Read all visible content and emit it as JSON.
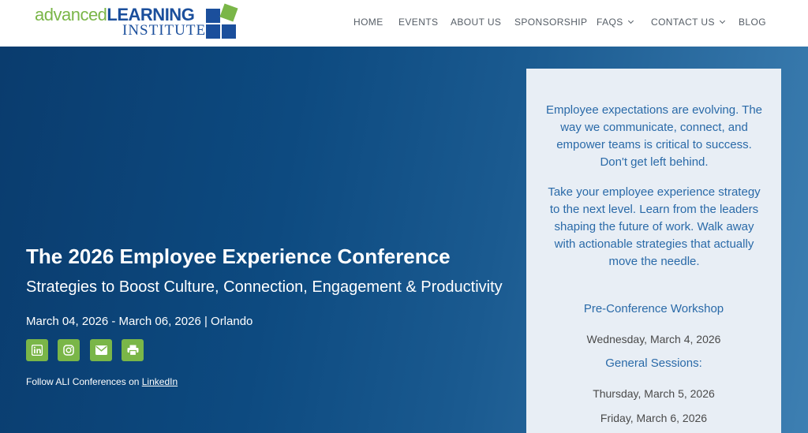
{
  "logo": {
    "word_advanced": "advanced",
    "word_learning": "LEARNING",
    "word_institute": "INSTITUTE",
    "colors": {
      "green": "#7ab648",
      "blue": "#1b4f9c"
    }
  },
  "nav": {
    "items": [
      {
        "label": "HOME"
      },
      {
        "label": "EVENTS"
      },
      {
        "label": "ABOUT US"
      },
      {
        "label": "SPONSORSHIP"
      },
      {
        "label": "FAQS",
        "has_dropdown": true
      },
      {
        "label": "CONTACT US",
        "has_dropdown": true
      },
      {
        "label": "BLOG"
      }
    ]
  },
  "hero": {
    "title": "The 2026 Employee Experience Conference",
    "subtitle": "Strategies to Boost Culture, Connection, Engagement & Productivity",
    "date_location": "March 04, 2026 - March 06, 2026 | Orlando",
    "social_icons": [
      "linkedin-icon",
      "instagram-icon",
      "email-icon",
      "print-icon"
    ],
    "follow_text": "Follow ALI Conferences on ",
    "follow_link": "LinkedIn"
  },
  "panel": {
    "paragraph1": "Employee expectations are evolving. The way we communicate, connect, and empower teams is critical to success. Don't get left behind.",
    "paragraph2": "Take your employee experience strategy to the next level. Learn from the leaders shaping the future of work. Walk away with actionable strategies that actually move the needle.",
    "workshop_heading": "Pre-Conference Workshop",
    "workshop_date": "Wednesday, March 4, 2026",
    "sessions_heading": "General Sessions:",
    "session_dates": [
      "Thursday, March 5, 2026",
      "Friday, March 6, 2026"
    ]
  },
  "colors": {
    "accent_green": "#7ab648",
    "hero_dark": "#0a3c6e",
    "panel_bg": "#e8eef5",
    "panel_text": "#2a6aa8"
  }
}
